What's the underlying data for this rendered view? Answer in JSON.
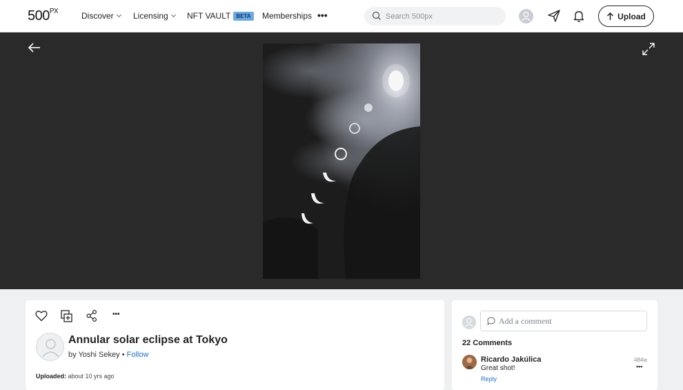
{
  "header": {
    "logo_text": "500",
    "logo_sup": "PX",
    "nav": [
      {
        "label": "Discover",
        "has_dropdown": true
      },
      {
        "label": "Licensing",
        "has_dropdown": true
      },
      {
        "label": "NFT VAULT",
        "badge": "BETA"
      },
      {
        "label": "Memberships"
      }
    ],
    "more_label": "•••",
    "search_placeholder": "Search 500px",
    "upload_label": "Upload"
  },
  "photo": {
    "title": "Annular solar eclipse at Tokyo",
    "by_prefix": "by",
    "author": "Yoshi Sekey",
    "separator": "•",
    "follow_label": "Follow",
    "uploaded_label": "Uploaded:",
    "uploaded_value": "about 10 yrs ago",
    "more_label": "•••"
  },
  "comments": {
    "placeholder": "Add a comment",
    "count_label": "22 Comments",
    "items": [
      {
        "author": "Ricardo Jakúlica",
        "text": "Great shot!",
        "reply_label": "Reply",
        "time": "484w",
        "more_label": "•••"
      }
    ]
  },
  "colors": {
    "viewer_bg": "#2a2a2a",
    "link": "#1b6fd1",
    "beta_badge": "#6aa9e6"
  }
}
